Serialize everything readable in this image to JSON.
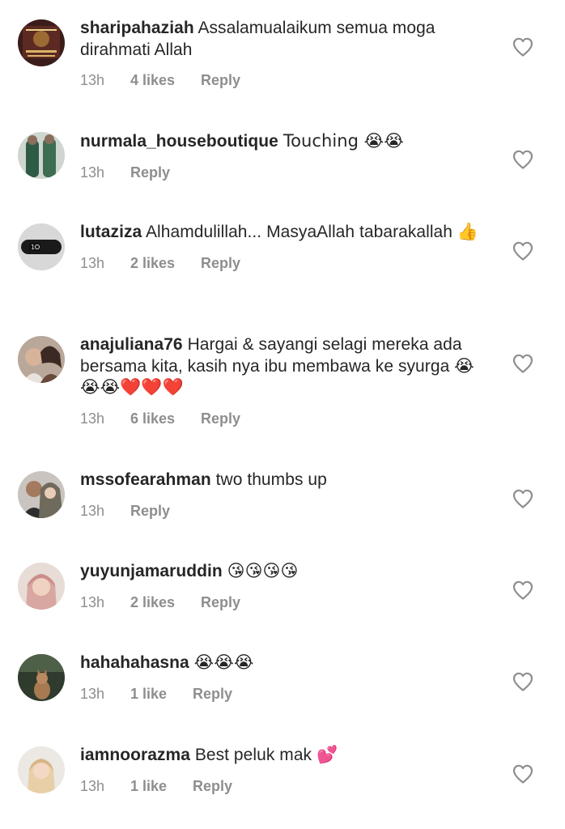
{
  "comments": [
    {
      "username": "sharipahaziah",
      "text": "Assalamualaikum semua moga dirahmati Allah",
      "time": "13h",
      "likes": "4 likes",
      "reply": "Reply",
      "avatar": "dark-gold-text-avatar"
    },
    {
      "username": "nurmala_houseboutique",
      "text": "Touching 😭😭",
      "time": "13h",
      "likes": "",
      "reply": "Reply",
      "avatar": "two-women-green-avatar"
    },
    {
      "username": "lutaziza",
      "text": "Alhamdulillah... MasyaAllah tabarakallah 👍",
      "time": "13h",
      "likes": "2 likes",
      "reply": "Reply",
      "avatar": "smart-band-avatar"
    },
    {
      "username": "anajuliana76",
      "text": "Hargai & sayangi selagi mereka ada bersama kita, kasih nya ibu membawa ke syurga 😭😭😭❤️❤️❤️",
      "time": "13h",
      "likes": "6 likes",
      "reply": "Reply",
      "avatar": "two-women-selfie-avatar"
    },
    {
      "username": "mssofearahman",
      "text": "two thumbs up",
      "time": "13h",
      "likes": "",
      "reply": "Reply",
      "avatar": "couple-avatar"
    },
    {
      "username": "yuyunjamaruddin",
      "text": "😘😘😘😘",
      "time": "13h",
      "likes": "2 likes",
      "reply": "Reply",
      "avatar": "woman-hijab-avatar"
    },
    {
      "username": "hahahahasna",
      "text": "😭😭😭",
      "time": "13h",
      "likes": "1 like",
      "reply": "Reply",
      "avatar": "cat-avatar"
    },
    {
      "username": "iamnoorazma",
      "text": "Best peluk mak 💕",
      "time": "13h",
      "likes": "1 like",
      "reply": "Reply",
      "avatar": "woman-hijab-light-avatar"
    }
  ],
  "icons": {
    "like": "heart-outline-icon"
  },
  "colors": {
    "text": "#262626",
    "meta": "#8e8e8e",
    "icon": "#8e8e8e",
    "background": "#ffffff"
  }
}
